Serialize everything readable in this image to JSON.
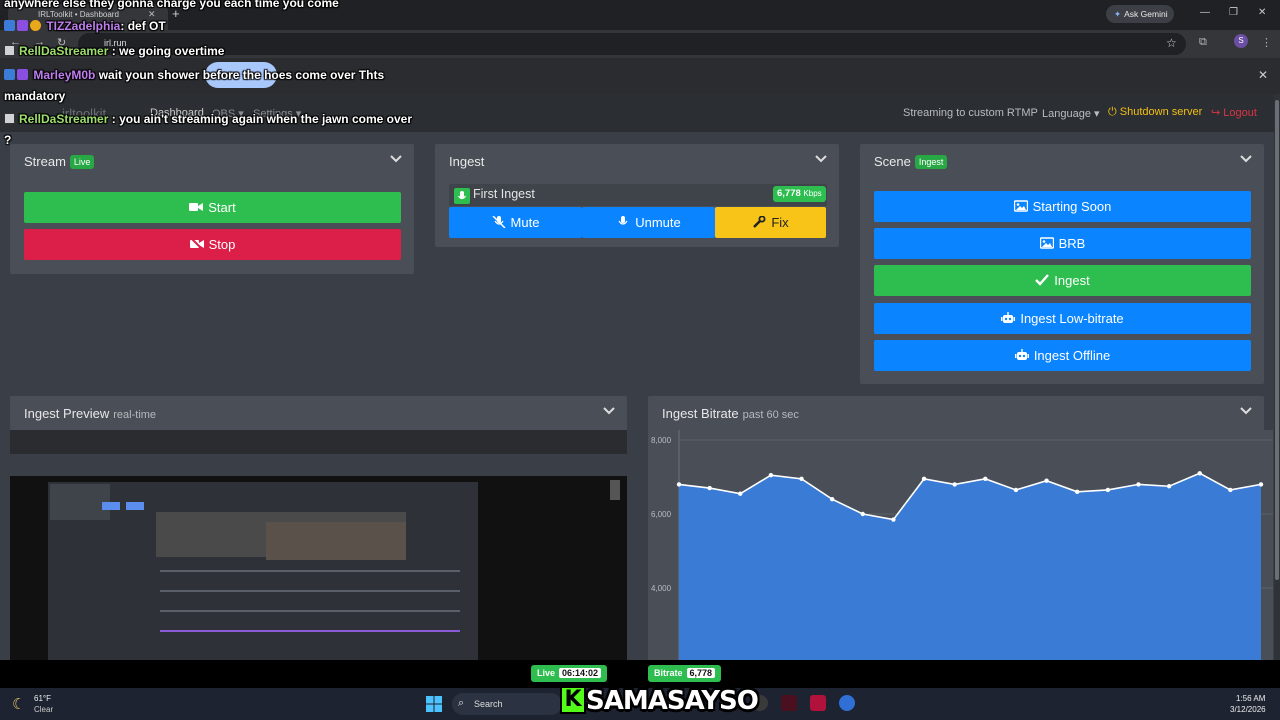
{
  "browser": {
    "tab_title": "IRLToolkit • Dashboard",
    "url": "irl.run",
    "ask_gemini": "Ask Gemini",
    "profile_initial": "S"
  },
  "navbar": {
    "brand": "irltoolkit",
    "links": [
      "Dashboard",
      "OBS",
      "Settings"
    ],
    "streaming_status": "Streaming to custom RTMP",
    "language": "Language",
    "shutdown": "Shutdown server",
    "logout": "Logout"
  },
  "stream_card": {
    "title": "Stream",
    "badge": "Live",
    "start_label": "Start",
    "stop_label": "Stop"
  },
  "ingest_card": {
    "title": "Ingest",
    "ingest_name": "First Ingest",
    "kbps_value": "6,778",
    "kbps_unit": "Kbps",
    "mute_label": "Mute",
    "unmute_label": "Unmute",
    "fix_label": "Fix"
  },
  "scene_card": {
    "title": "Scene",
    "badge": "Ingest",
    "scenes": [
      {
        "label": "Starting Soon",
        "icon": "image-icon",
        "active": false
      },
      {
        "label": "BRB",
        "icon": "image-icon",
        "active": false
      },
      {
        "label": "Ingest",
        "icon": "check-icon",
        "active": true
      },
      {
        "label": "Ingest Low-bitrate",
        "icon": "robot-icon",
        "active": false
      },
      {
        "label": "Ingest Offline",
        "icon": "robot-icon",
        "active": false
      }
    ]
  },
  "preview_card": {
    "title": "Ingest Preview",
    "subtitle": "real-time"
  },
  "bitrate_card": {
    "title": "Ingest Bitrate",
    "subtitle": "past 60 sec"
  },
  "chart_data": {
    "type": "area",
    "title": "Ingest Bitrate",
    "subtitle": "past 60 sec",
    "y_ticks": [
      "8,000",
      "6,000",
      "4,000"
    ],
    "ylim": [
      0,
      8000
    ],
    "values": [
      6800,
      6700,
      6550,
      7050,
      6950,
      6400,
      6000,
      5850,
      6950,
      6800,
      6950,
      6650,
      6900,
      6600,
      6650,
      6800,
      6750,
      7100,
      6650,
      6800
    ],
    "fill_color": "#3a7bd5",
    "line_color": "#ffffff"
  },
  "chat": [
    {
      "user": "",
      "message": "anywhere else they gonna charge you each time you come"
    },
    {
      "user": "TIZZadelphia",
      "message": ": def OT"
    },
    {
      "user": "RellDaStreamer",
      "message": ": we going overtime"
    },
    {
      "user": "MarleyM0b",
      "message": "wait youn shower before the hoes come over Thts"
    },
    {
      "user": "",
      "message": "mandatory"
    },
    {
      "user": "RellDaStreamer",
      "message": ": you ain't streaming again when the jawn come over"
    },
    {
      "user": "",
      "message": "?"
    }
  ],
  "status_pills": {
    "live_label": "Live",
    "live_value": "06:14:02",
    "bitrate_label": "Bitrate",
    "bitrate_value": "6,778"
  },
  "taskbar": {
    "temperature": "61°F",
    "weather": "Clear",
    "search_placeholder": "Search",
    "brand_overlay": "SAMASAYSO",
    "brand_letter": "K",
    "time": "1:56 AM",
    "date": "3/12/2026"
  },
  "colors": {
    "green": "#2ebd4f",
    "red": "#dc1f48",
    "blue": "#0a84ff",
    "yellow": "#f8c417"
  }
}
